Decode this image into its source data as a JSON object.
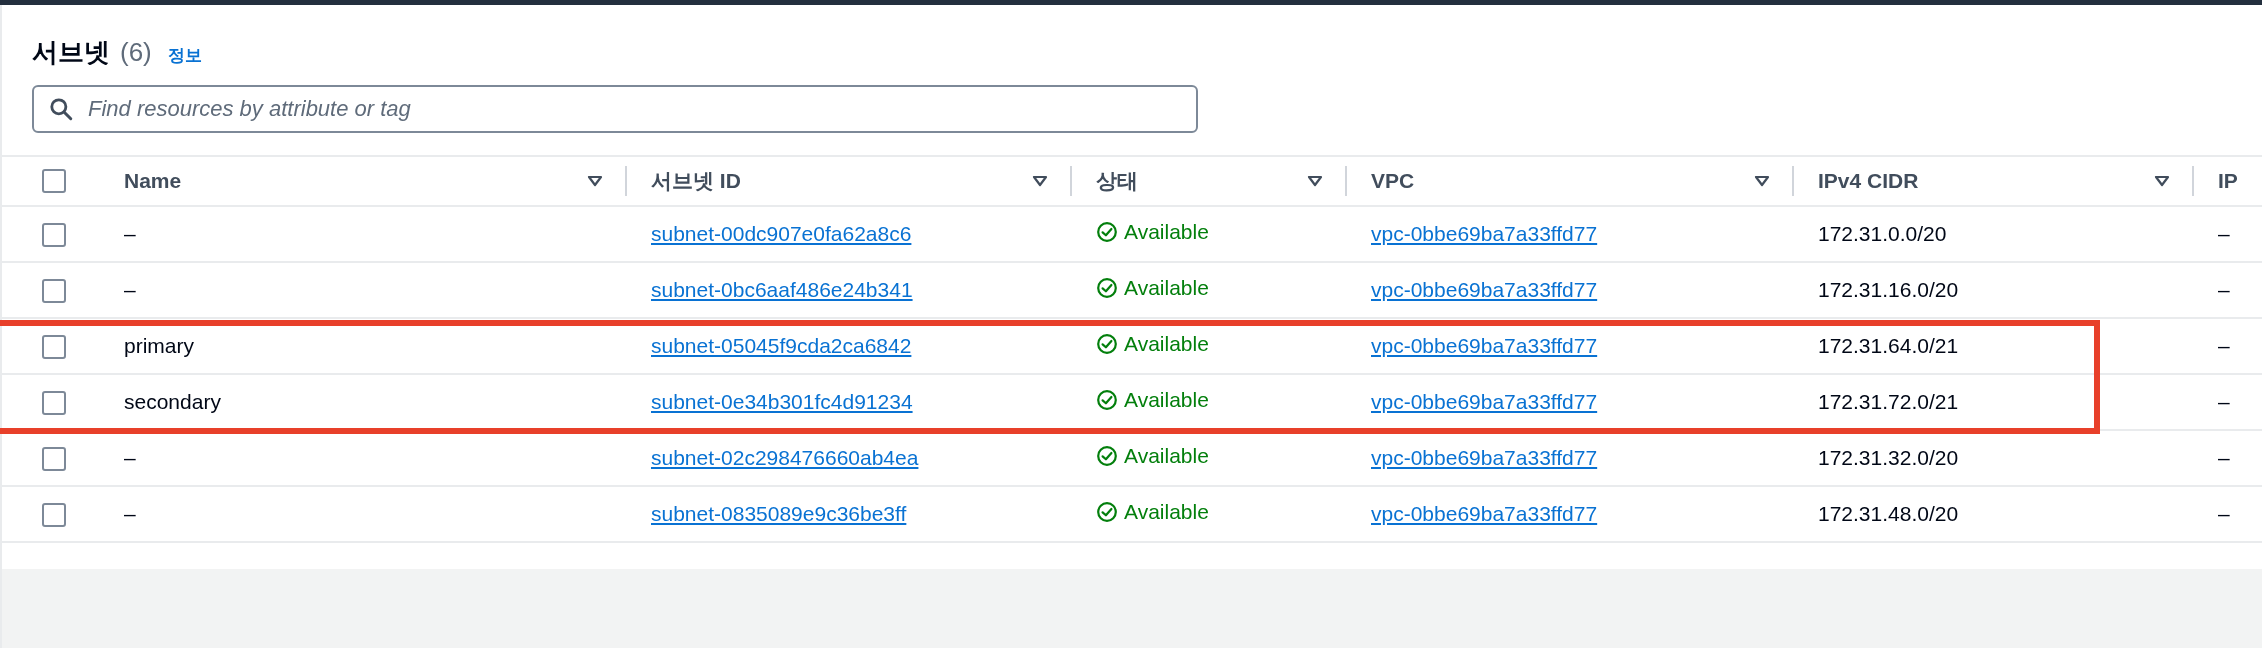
{
  "panel": {
    "title": "서브넷",
    "count": "(6)",
    "info_link": "정보"
  },
  "search": {
    "placeholder": "Find resources by attribute or tag"
  },
  "table": {
    "select_all": {
      "checked": false
    },
    "columns": [
      {
        "label": "Name",
        "sortable": true
      },
      {
        "label": "서브넷 ID",
        "sortable": true
      },
      {
        "label": "상태",
        "sortable": true
      },
      {
        "label": "VPC",
        "sortable": true
      },
      {
        "label": "IPv4 CIDR",
        "sortable": true
      },
      {
        "label": "IP",
        "sortable": false
      }
    ],
    "rows": [
      {
        "checked": false,
        "highlighted": false,
        "name": "–",
        "subnet_id": "subnet-00dc907e0fa62a8c6",
        "state": {
          "kind": "available",
          "label": "Available"
        },
        "vpc": "vpc-0bbe69ba7a33ffd77",
        "ipv4_cidr": "172.31.0.0/20",
        "column_6": "–"
      },
      {
        "checked": false,
        "highlighted": false,
        "name": "–",
        "subnet_id": "subnet-0bc6aaf486e24b341",
        "state": {
          "kind": "available",
          "label": "Available"
        },
        "vpc": "vpc-0bbe69ba7a33ffd77",
        "ipv4_cidr": "172.31.16.0/20",
        "column_6": "–"
      },
      {
        "checked": false,
        "highlighted": true,
        "name": "primary",
        "subnet_id": "subnet-05045f9cda2ca6842",
        "state": {
          "kind": "available",
          "label": "Available"
        },
        "vpc": "vpc-0bbe69ba7a33ffd77",
        "ipv4_cidr": "172.31.64.0/21",
        "column_6": "–"
      },
      {
        "checked": false,
        "highlighted": true,
        "name": "secondary",
        "subnet_id": "subnet-0e34b301fc4d91234",
        "state": {
          "kind": "available",
          "label": "Available"
        },
        "vpc": "vpc-0bbe69ba7a33ffd77",
        "ipv4_cidr": "172.31.72.0/21",
        "column_6": "–"
      },
      {
        "checked": false,
        "highlighted": false,
        "name": "–",
        "subnet_id": "subnet-02c298476660ab4ea",
        "state": {
          "kind": "available",
          "label": "Available"
        },
        "vpc": "vpc-0bbe69ba7a33ffd77",
        "ipv4_cidr": "172.31.32.0/20",
        "column_6": "–"
      },
      {
        "checked": false,
        "highlighted": false,
        "name": "–",
        "subnet_id": "subnet-0835089e9c36be3ff",
        "state": {
          "kind": "available",
          "label": "Available"
        },
        "vpc": "vpc-0bbe69ba7a33ffd77",
        "ipv4_cidr": "172.31.48.0/20",
        "column_6": "–"
      }
    ]
  }
}
